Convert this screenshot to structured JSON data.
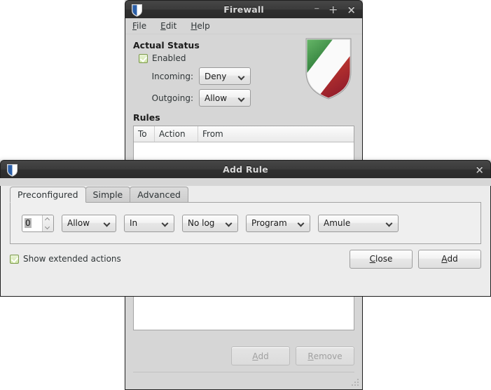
{
  "colors": {
    "titlebar_dark": "#3b3b3b",
    "window_bg": "#d6d6d6",
    "dialog_bg": "#ececec",
    "accent_green": "#76a029",
    "shield_green": "#2f8f3f",
    "shield_red": "#c32b22"
  },
  "firewall_window": {
    "title": "Firewall",
    "icon": "shield-icon",
    "window_controls": {
      "minimize": "–",
      "maximize": "+",
      "close": "×"
    },
    "menubar": [
      {
        "label": "File",
        "accel": "F",
        "rest": "ile"
      },
      {
        "label": "Edit",
        "accel": "E",
        "rest": "dit"
      },
      {
        "label": "Help",
        "accel": "H",
        "rest": "elp"
      }
    ],
    "status_section": {
      "heading": "Actual Status",
      "enabled_label": "Enabled",
      "enabled_checked": true,
      "incoming_label": "Incoming:",
      "incoming_value": "Deny",
      "outgoing_label": "Outgoing:",
      "outgoing_value": "Allow"
    },
    "rules_section": {
      "heading": "Rules",
      "columns": [
        "To",
        "Action",
        "From"
      ],
      "rows": []
    },
    "footer_buttons": [
      {
        "label": "Add",
        "accel": "A",
        "before": "",
        "after": "dd",
        "disabled": true
      },
      {
        "label": "Remove",
        "accel": "R",
        "before": "",
        "after": "emove",
        "disabled": true
      }
    ]
  },
  "add_rule_dialog": {
    "title": "Add Rule",
    "icon": "shield-icon",
    "close_label": "×",
    "tabs": [
      {
        "label": "Preconfigured",
        "active": true
      },
      {
        "label": "Simple",
        "active": false
      },
      {
        "label": "Advanced",
        "active": false
      }
    ],
    "rule_row": {
      "priority_value": "0",
      "action_value": "Allow",
      "direction_value": "In",
      "log_value": "No log",
      "type_value": "Program",
      "program_value": "Amule"
    },
    "show_extended_label": "Show extended actions",
    "show_extended_checked": true,
    "buttons": [
      {
        "label": "Close",
        "accel": "C",
        "after": "lose"
      },
      {
        "label": "Add",
        "accel": "A",
        "after": "dd"
      }
    ]
  }
}
